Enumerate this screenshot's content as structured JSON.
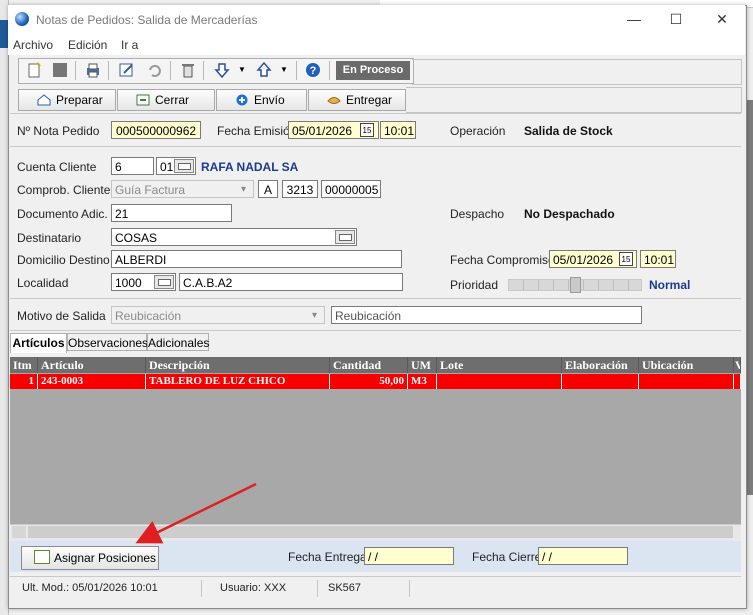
{
  "window": {
    "title": "Notas de Pedidos: Salida de Mercaderías",
    "controls": {
      "minimize": "—",
      "maximize": "☐",
      "close": "✕"
    }
  },
  "menu": [
    "Archivo",
    "Edición",
    "Ir a"
  ],
  "toolbar": {
    "status": "En Proceso",
    "icons": [
      "new-document-icon",
      "stop-icon",
      "print-icon",
      "edit-icon",
      "undo-icon",
      "delete-icon",
      "arrow-down-icon",
      "dropdown-icon",
      "arrow-up-icon",
      "dropdown-icon",
      "help-icon"
    ]
  },
  "actions": {
    "preparar": "Preparar",
    "cerrar": "Cerrar",
    "envio": "Envío",
    "entregar": "Entregar"
  },
  "header": {
    "nro_label": "Nº Nota Pedido",
    "nro_value": "000500000962",
    "fecha_emision_label": "Fecha Emisión",
    "fecha_emision": "05/01/2026",
    "hora_emision": "10:01",
    "operacion_label": "Operación",
    "operacion_value": "Salida de Stock",
    "calendar_glyph": "15"
  },
  "form": {
    "cuenta_label": "Cuenta Cliente",
    "cuenta_value": "6",
    "cuenta_sub": "01",
    "cuenta_name": "RAFA NADAL SA",
    "comprob_label": "Comprob. Cliente",
    "comprob_tipo": "Guía Factura",
    "comprob_letra": "A",
    "comprob_pv": "3213",
    "comprob_nro": "00000005",
    "docadic_label": "Documento Adic.",
    "docadic_value": "21",
    "despacho_label": "Despacho",
    "despacho_value": "No Despachado",
    "destinatario_label": "Destinatario",
    "destinatario_value": "COSAS",
    "domicilio_label": "Domicilio Destino",
    "domicilio_value": "ALBERDI",
    "fecha_compromiso_label": "Fecha Compromiso",
    "fecha_compromiso": "05/01/2026",
    "hora_compromiso": "10:01",
    "localidad_label": "Localidad",
    "localidad_cp": "1000",
    "localidad_name": "C.A.B.A2",
    "prioridad_label": "Prioridad",
    "prioridad_value": "Normal",
    "prioridad_level": 0.5,
    "motivo_label": "Motivo de Salida",
    "motivo_value": "Reubicación",
    "motivo_desc": "Reubicación"
  },
  "tabs": [
    "Artículos",
    "Observaciones",
    "Adicionales"
  ],
  "grid": {
    "columns": [
      "Itm",
      "Artículo",
      "Descripción",
      "Cantidad",
      "UM",
      "Lote",
      "Elaboración",
      "Ubicación",
      "V"
    ],
    "rows": [
      {
        "itm": "1",
        "articulo": "243-0003",
        "descripcion": "TABLERO DE LUZ CHICO",
        "cantidad": "50,00",
        "um": "M3",
        "lote": "",
        "elaboracion": "",
        "ubicacion": ""
      }
    ]
  },
  "bottom": {
    "asignar_label": "Asignar Posiciones",
    "fecha_entrega_label": "Fecha Entrega",
    "fecha_entrega_value": " / /",
    "fecha_cierre_label": "Fecha Cierre",
    "fecha_cierre_value": " / /"
  },
  "status": {
    "ult_mod": "Ult. Mod.: 05/01/2026 10:01",
    "usuario": "Usuario: XXX",
    "code": "SK567"
  },
  "colors": {
    "selected_row": "#f80000",
    "grid_header": "#6e6e6e",
    "yellow_field": "#ffffcf",
    "annotation_arrow": "#e02020"
  }
}
